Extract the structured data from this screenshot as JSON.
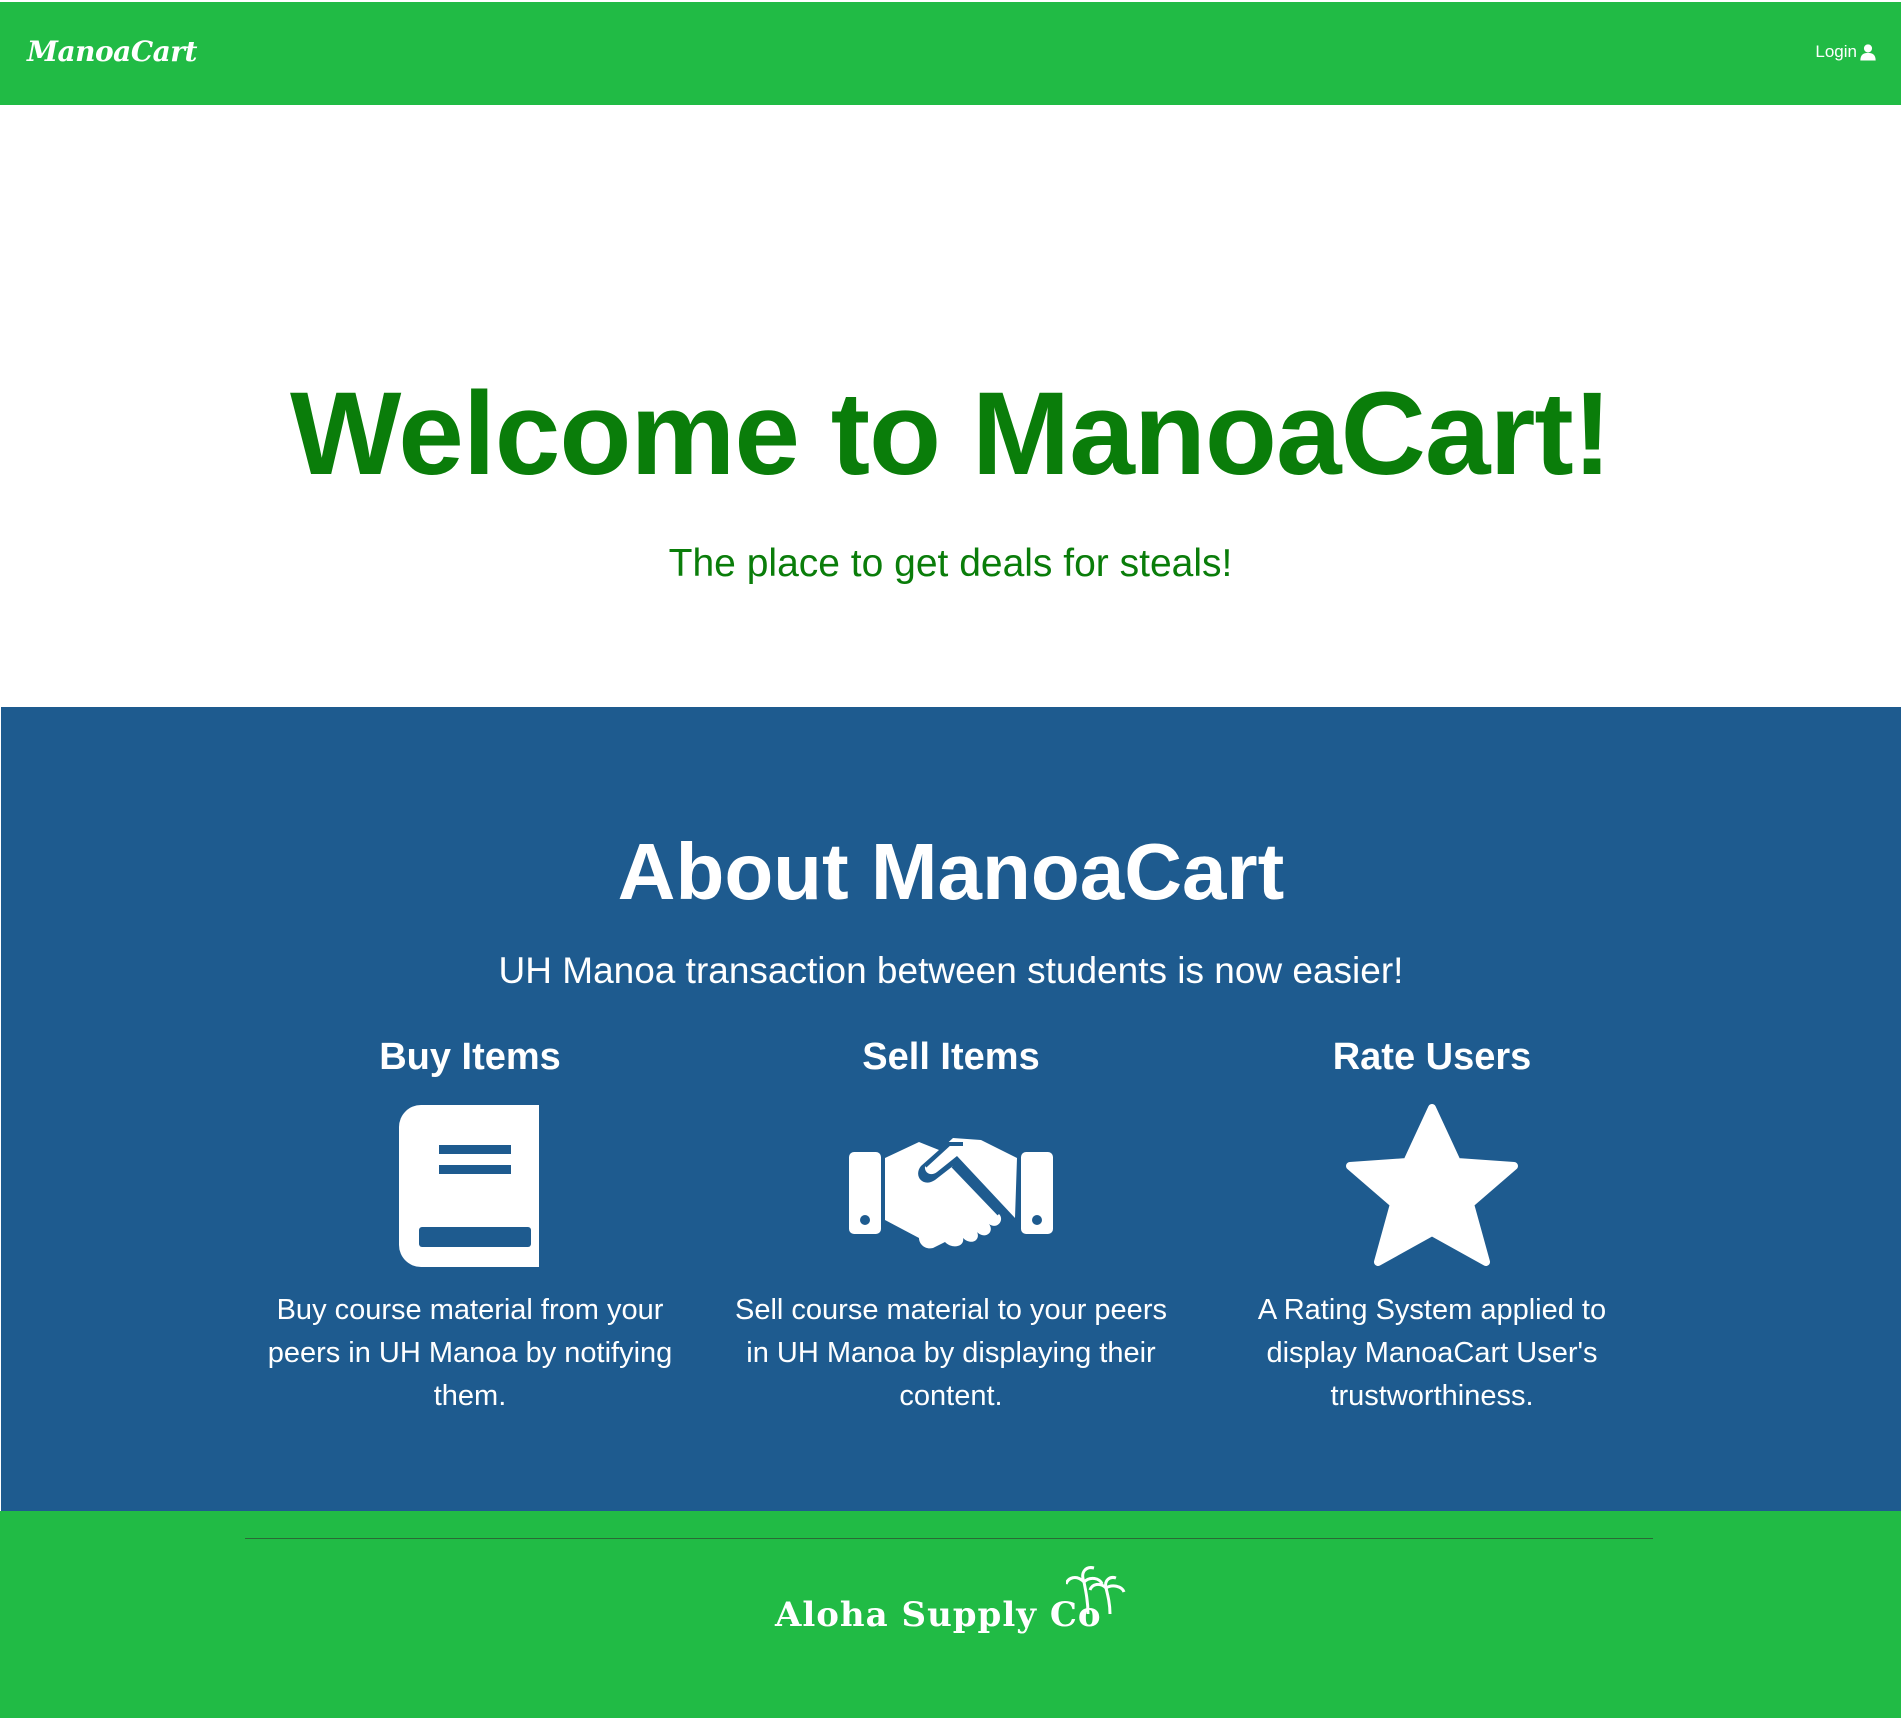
{
  "navbar": {
    "brand": "ManoaCart",
    "login_label": "Login",
    "bg_color": "#21bb45"
  },
  "hero": {
    "title": "Welcome to ManoaCart!",
    "subtitle": "The place to get deals for steals!",
    "text_color": "#0a7d0a"
  },
  "about": {
    "title": "About ManoaCart",
    "subtitle": "UH Manoa transaction between students is now easier!",
    "bg_color": "#1e5b8f",
    "features": [
      {
        "title": "Buy Items",
        "icon": "book-icon",
        "description": "Buy course material from your peers in UH Manoa by notifying them."
      },
      {
        "title": "Sell Items",
        "icon": "handshake-icon",
        "description": "Sell course material to your peers in UH Manoa by displaying their content."
      },
      {
        "title": "Rate Users",
        "icon": "star-icon",
        "description": "A Rating System applied to display ManoaCart User's trustworthiness."
      }
    ]
  },
  "footer": {
    "logo_text": "Aloha Supply Co",
    "logo_icon": "palm-trees-icon"
  }
}
